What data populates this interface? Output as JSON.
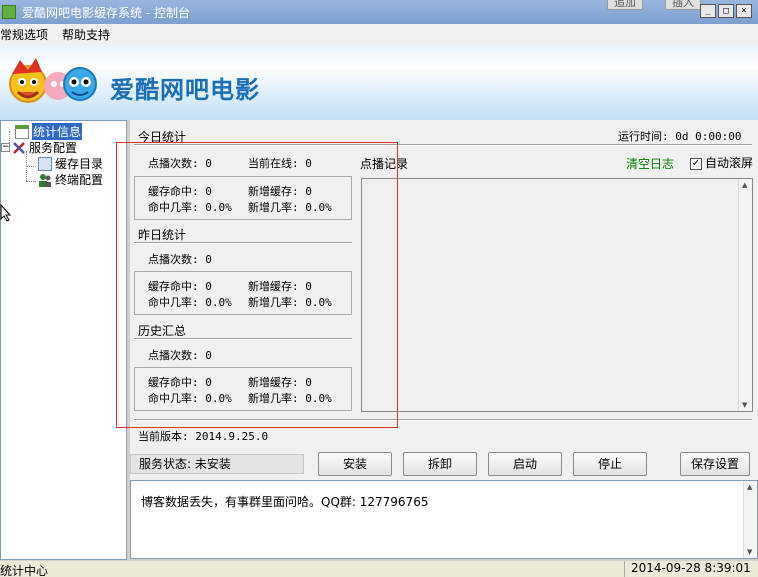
{
  "window": {
    "title": "爱酷网吧电影缓存系统 - 控制台",
    "bg_buttons": [
      "追加",
      "插入"
    ],
    "controls": [
      "_",
      "□",
      "×"
    ]
  },
  "menu": {
    "items": [
      "常规选项",
      "帮助支持"
    ]
  },
  "banner": {
    "brand": "爱酷网吧电影"
  },
  "tree": {
    "root": "统计信息",
    "service": "服务配置",
    "cache_dir": "缓存目录",
    "terminal": "终端配置"
  },
  "today": {
    "title": "今日统计",
    "runtime": "运行时间: 0d 0:00:00",
    "plays": "点播次数: 0",
    "online": "当前在线: 0",
    "cache_hit": "缓存命中: 0",
    "new_cache": "新增缓存: 0",
    "hit_rate": "命中几率: 0.0%",
    "new_rate": "新增几率: 0.0%"
  },
  "yesterday": {
    "title": "昨日统计",
    "plays": "点播次数: 0",
    "cache_hit": "缓存命中: 0",
    "new_cache": "新增缓存: 0",
    "hit_rate": "命中几率: 0.0%",
    "new_rate": "新增几率: 0.0%"
  },
  "history": {
    "title": "历史汇总",
    "plays": "点播次数: 0",
    "cache_hit": "缓存命中: 0",
    "new_cache": "新增缓存: 0",
    "hit_rate": "命中几率: 0.0%",
    "new_rate": "新增几率: 0.0%"
  },
  "log": {
    "title": "点播记录",
    "clear_label": "清空日志",
    "autoscroll_label": "自动滚屏",
    "autoscroll_checked": "✓"
  },
  "version": "当前版本: 2014.9.25.0",
  "service": {
    "status": "服务状态: 未安装",
    "install": "安装",
    "uninstall": "拆卸",
    "start": "启动",
    "stop": "停止",
    "save": "保存设置"
  },
  "message": "博客数据丢失，有事群里面问哈。QQ群: 127796765",
  "statusbar": {
    "left": "统计中心",
    "datetime": "2014-09-28 8:39:01"
  },
  "colors": {
    "accent": "#316ac5",
    "clear_log": "#008000",
    "brand": "#1b6fb8",
    "highlight_box": "#e03030"
  }
}
